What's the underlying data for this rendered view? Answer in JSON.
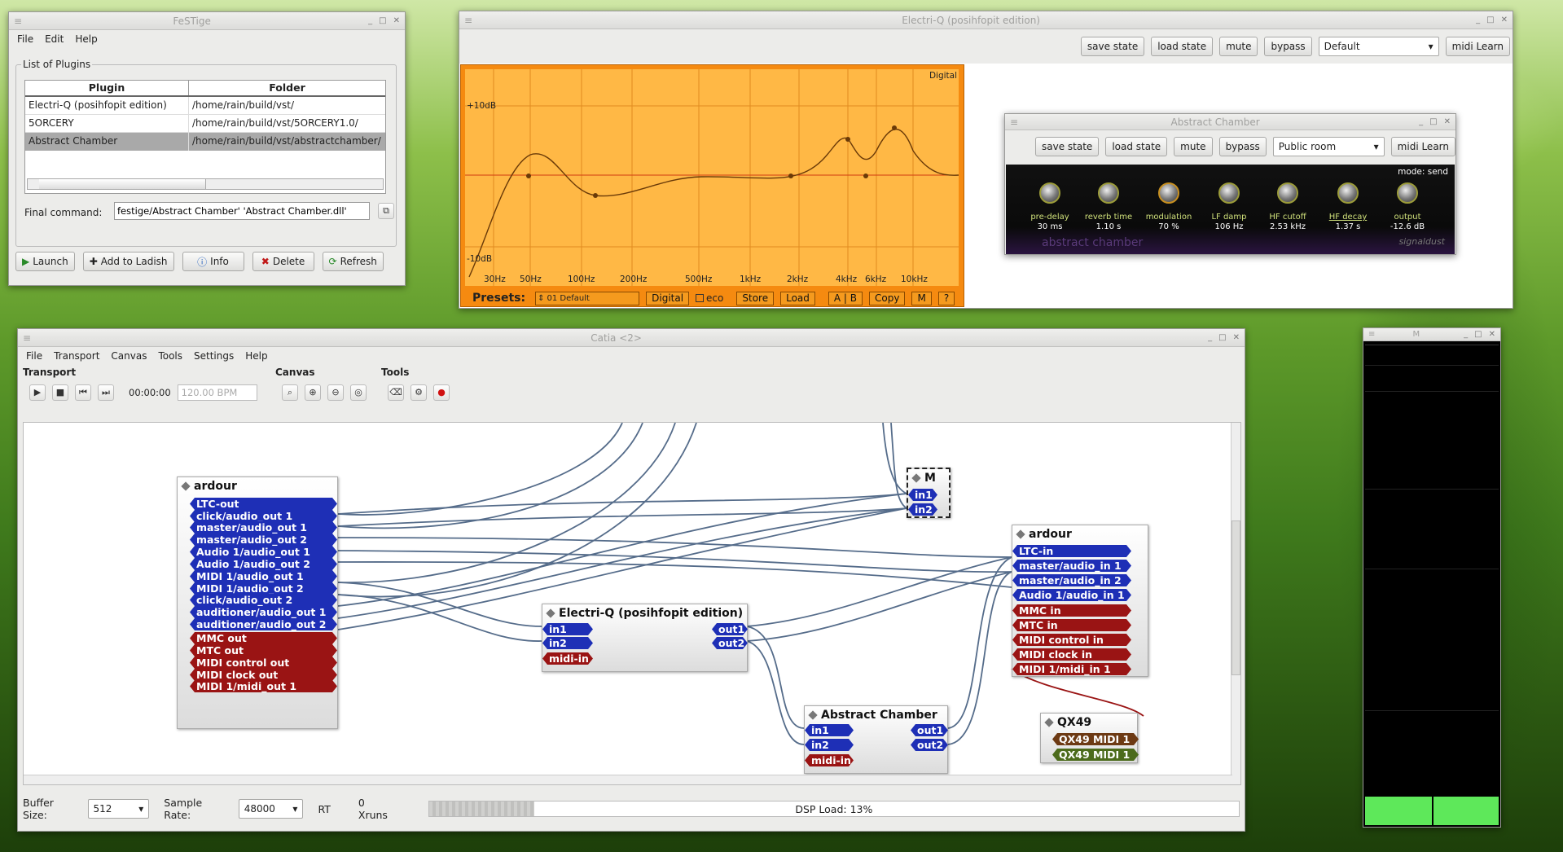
{
  "festige": {
    "title": "FeSTige",
    "menu": [
      "File",
      "Edit",
      "Help"
    ],
    "group_label": "List of Plugins",
    "columns": [
      "Plugin",
      "Folder"
    ],
    "rows": [
      [
        "Electri-Q (posihfopit edition)",
        "/home/rain/build/vst/"
      ],
      [
        "5ORCERY",
        "/home/rain/build/vst/5ORCERY1.0/"
      ],
      [
        "Abstract Chamber",
        "/home/rain/build/vst/abstractchamber/"
      ]
    ],
    "final_label": "Final command:",
    "final_value": "festige/Abstract Chamber' 'Abstract Chamber.dll'",
    "buttons": {
      "launch": "Launch",
      "add": "Add to Ladish",
      "info": "Info",
      "delete": "Delete",
      "refresh": "Refresh"
    }
  },
  "electriq": {
    "title": "Electri-Q (posihfopit edition)",
    "toolbar": {
      "save": "save state",
      "load": "load state",
      "mute": "mute",
      "bypass": "bypass",
      "preset": "Default",
      "midi": "midi Learn"
    },
    "eq": {
      "mode": "Digital",
      "plus": "+10dB",
      "minus": "-10dB",
      "freqs": [
        "30Hz",
        "50Hz",
        "100Hz",
        "200Hz",
        "500Hz",
        "1kHz",
        "2kHz",
        "4kHz",
        "6kHz",
        "10kHz"
      ],
      "presets_label": "Presets:",
      "preset_value": "01 Default",
      "digital": "Digital",
      "eco": "eco",
      "store": "Store",
      "load": "Load",
      "ab": "A | B",
      "copy": "Copy",
      "m": "M",
      "q": "?"
    }
  },
  "chamber": {
    "title": "Abstract Chamber",
    "toolbar": {
      "save": "save state",
      "load": "load state",
      "mute": "mute",
      "bypass": "bypass",
      "preset": "Public room",
      "midi": "midi Learn"
    },
    "mode": "mode: send",
    "brand": "abstract chamber",
    "vendor": "signaldust",
    "knobs": [
      {
        "label": "pre-delay",
        "value": "30 ms"
      },
      {
        "label": "reverb time",
        "value": "1.10 s"
      },
      {
        "label": "modulation",
        "value": "70 %"
      },
      {
        "label": "LF damp",
        "value": "106 Hz"
      },
      {
        "label": "HF cutoff",
        "value": "2.53 kHz"
      },
      {
        "label": "HF decay",
        "value": "1.37 s"
      },
      {
        "label": "output",
        "value": "-12.6 dB"
      }
    ]
  },
  "catia": {
    "title": "Catia <2>",
    "menu": [
      "File",
      "Transport",
      "Canvas",
      "Tools",
      "Settings",
      "Help"
    ],
    "sections": {
      "transport": "Transport",
      "canvas": "Canvas",
      "tools": "Tools"
    },
    "time": "00:00:00",
    "bpm": "120.00 BPM",
    "status": {
      "buffer_label": "Buffer Size:",
      "buffer": "512",
      "rate_label": "Sample Rate:",
      "rate": "48000",
      "rt": "RT",
      "xruns": "0 Xruns",
      "dsp": "DSP Load: 13%",
      "dsp_load": 0.13
    },
    "nodes": {
      "ardour_out": {
        "title": "ardour",
        "ports": [
          "LTC-out",
          "click/audio_out 1",
          "master/audio_out 1",
          "master/audio_out 2",
          "Audio 1/audio_out 1",
          "Audio 1/audio_out 2",
          "MIDI 1/audio_out 1",
          "MIDI 1/audio_out 2",
          "click/audio_out 2",
          "auditioner/audio_out 1",
          "auditioner/audio_out 2"
        ],
        "midi": [
          "MMC out",
          "MTC out",
          "MIDI control out",
          "MIDI clock out",
          "MIDI 1/midi_out 1"
        ]
      },
      "m": {
        "title": "M",
        "ports": [
          "in1",
          "in2"
        ]
      },
      "eq": {
        "title": "Electri-Q (posihfopit edition)",
        "in": [
          "in1",
          "in2"
        ],
        "midi": "midi-in",
        "out": [
          "out1",
          "out2"
        ]
      },
      "chamber": {
        "title": "Abstract Chamber",
        "in": [
          "in1",
          "in2"
        ],
        "midi": "midi-in",
        "out": [
          "out1",
          "out2"
        ]
      },
      "ardour_in": {
        "title": "ardour",
        "ports": [
          "LTC-in",
          "master/audio_in 1",
          "master/audio_in 2",
          "Audio 1/audio_in 1"
        ],
        "midi": [
          "MMC in",
          "MTC in",
          "MIDI control in",
          "MIDI clock in",
          "MIDI 1/midi_in 1"
        ]
      },
      "qx49": {
        "title": "QX49",
        "ports": [
          "QX49 MIDI 1",
          "QX49 MIDI 1"
        ]
      }
    }
  },
  "meter": {
    "title": "M",
    "levels": [
      0.06,
      0.06
    ]
  }
}
